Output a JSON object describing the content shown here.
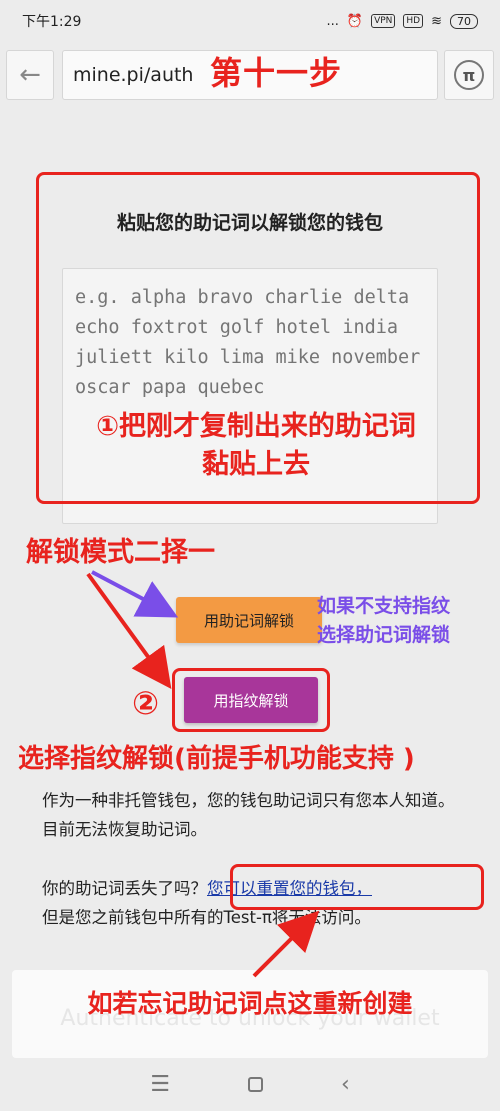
{
  "status_bar": {
    "time": "下午1:29",
    "dots": "...",
    "vpn": "VPN",
    "hd": "HD",
    "battery": "70"
  },
  "browser": {
    "url": "mine.pi/auth",
    "back_icon": "arrow-left-icon",
    "pi_icon": "pi-logo-icon",
    "pi_glyph": "π"
  },
  "annotations": {
    "step": "第十一步",
    "paste_hint_circle": "①",
    "paste_hint_line1": "把刚才复制出来的助记词",
    "paste_hint_line2": "黏贴上去",
    "mode_choice": "解锁模式二择一",
    "mnemonic_hint_line1": "如果不支持指纹",
    "mnemonic_hint_line2": "选择助记词解锁",
    "circled_two": "②",
    "fingerprint_hint": "选择指纹解锁(前提手机功能支持 )",
    "forgot_hint": "如若忘记助记词点这重新创建"
  },
  "unlock": {
    "title": "粘贴您的助记词以解锁您的钱包",
    "placeholder": "e.g. alpha bravo charlie delta echo foxtrot golf hotel india juliett kilo lima mike november oscar papa quebec",
    "mnemonic_button": "用助记词解锁",
    "fingerprint_button": "用指纹解锁",
    "info_text": "作为一种非托管钱包，您的钱包助记词只有您本人知道。 目前无法恢复助记词。",
    "lost_question": "你的助记词丢失了吗？",
    "reset_link": "您可以重置您的钱包，",
    "lost_tail": "但是您之前钱包中所有的Test-π将无法访问。",
    "ghost_button": "Authenticate to unlock your wallet"
  },
  "nav": {
    "menu": "☰",
    "back": "‹"
  },
  "colors": {
    "annotation_red": "#e8231e",
    "annotation_purple": "#7a4ee8",
    "mnemonic_button": "#f39a43",
    "fingerprint_button": "#a8369a",
    "link": "#1a3aa8"
  }
}
